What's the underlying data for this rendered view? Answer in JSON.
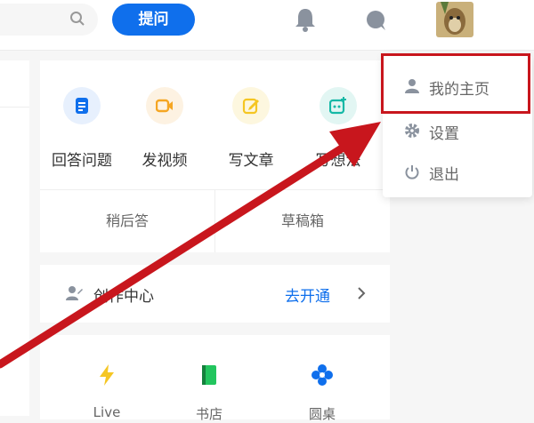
{
  "header": {
    "ask_label": "提问",
    "icons": [
      "search-icon",
      "bell-icon",
      "chat-icon",
      "avatar"
    ]
  },
  "actions": [
    {
      "label": "回答问题",
      "icon": "document-icon",
      "color": "#0f6fec"
    },
    {
      "label": "发视频",
      "icon": "video-icon",
      "color": "#f5a623"
    },
    {
      "label": "写文章",
      "icon": "pencil-icon",
      "color": "#f5c623"
    },
    {
      "label": "写想法",
      "icon": "idea-icon",
      "color": "#14b8a6"
    }
  ],
  "sub_actions": [
    "稍后答",
    "草稿箱"
  ],
  "creator": {
    "label": "创作中心",
    "link": "去开通"
  },
  "bottom_items": [
    {
      "label": "Live",
      "icon": "lightning-icon",
      "color": "#f5c623"
    },
    {
      "label": "书店",
      "icon": "book-icon",
      "color": "#22c55e"
    },
    {
      "label": "圆桌",
      "icon": "pinwheel-icon",
      "color": "#0f6fec"
    }
  ],
  "menu": {
    "items": [
      {
        "label": "我的主页",
        "icon": "person-icon"
      },
      {
        "label": "设置",
        "icon": "gear-icon"
      },
      {
        "label": "退出",
        "icon": "power-icon"
      }
    ]
  },
  "colors": {
    "accent": "#0f6fec",
    "annotation": "#c8161d"
  }
}
